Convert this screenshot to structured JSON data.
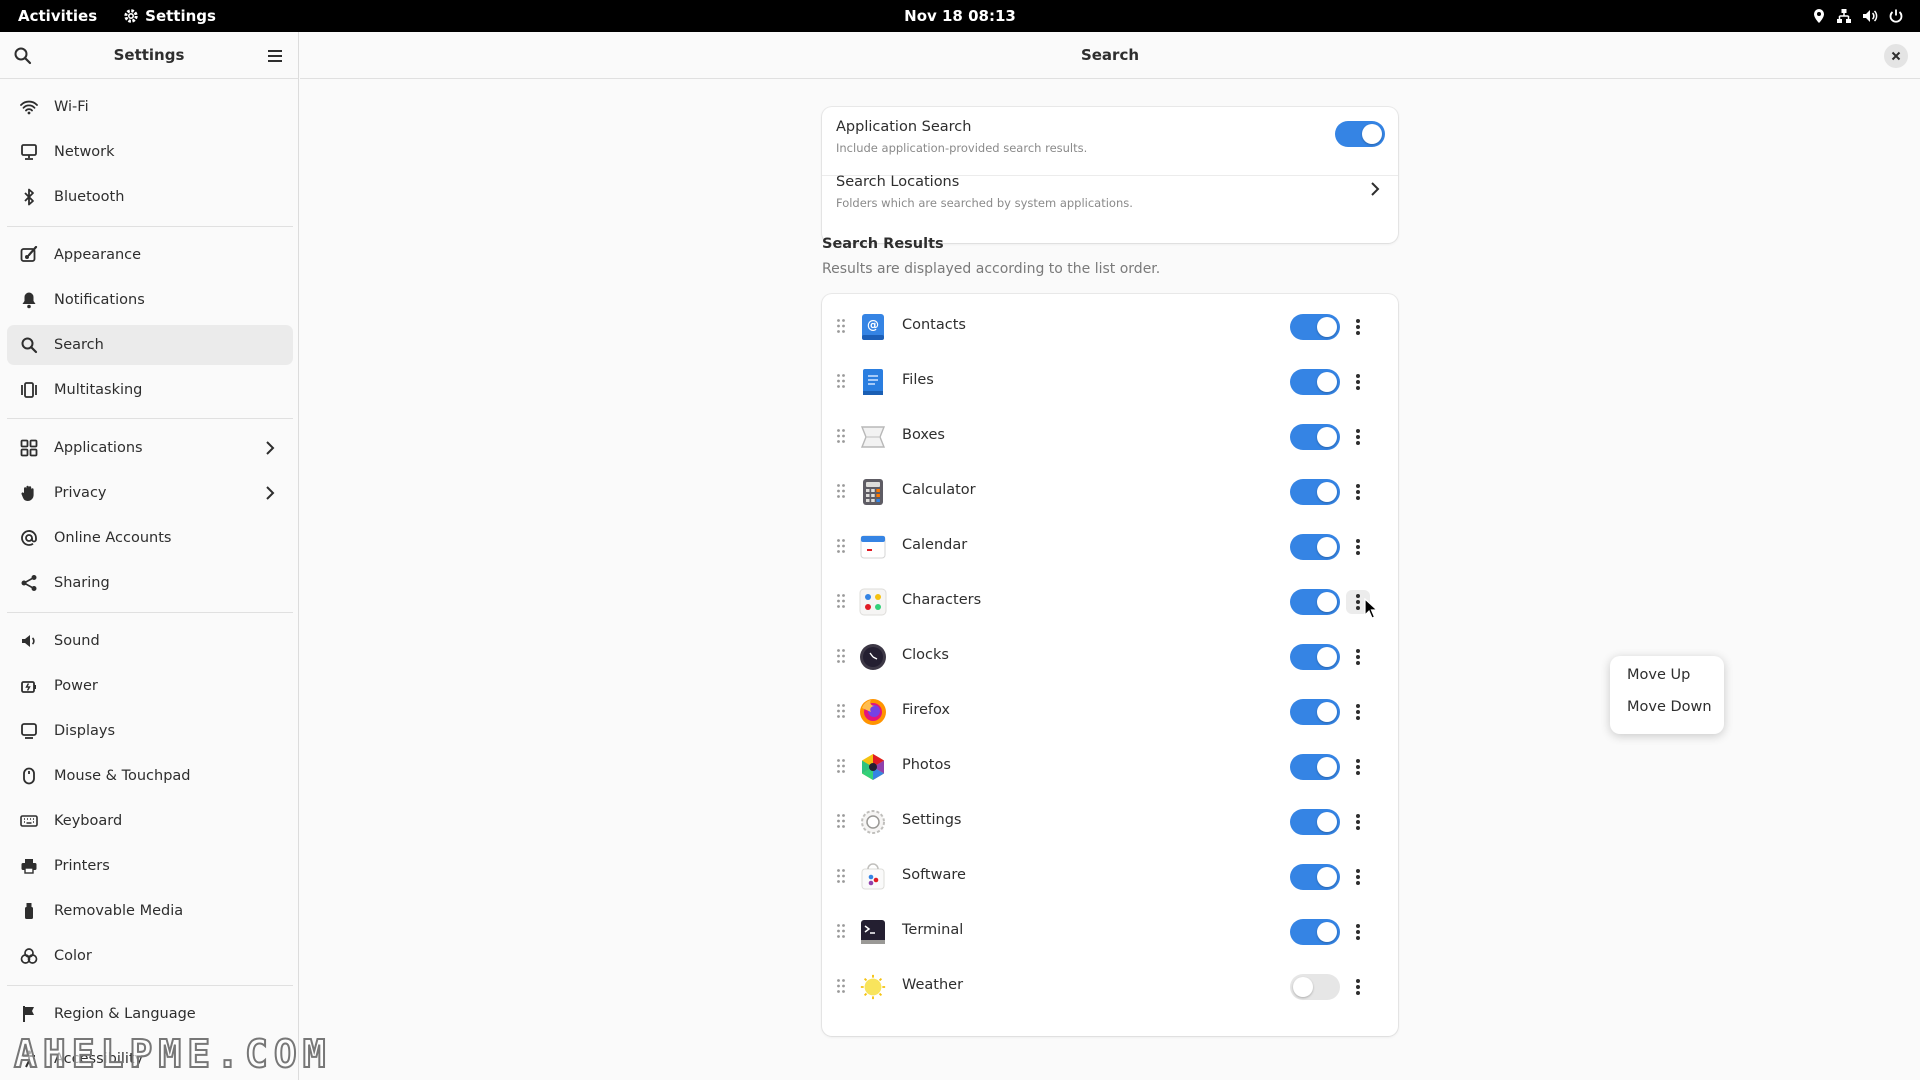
{
  "topbar": {
    "activities": "Activities",
    "app_name": "Settings",
    "datetime": "Nov 18  08:13"
  },
  "sidebar": {
    "title": "Settings",
    "items": [
      {
        "label": "Wi-Fi",
        "icon": "wifi-icon"
      },
      {
        "label": "Network",
        "icon": "network-icon"
      },
      {
        "label": "Bluetooth",
        "icon": "bluetooth-icon"
      },
      {
        "label": "Appearance",
        "icon": "appearance-icon"
      },
      {
        "label": "Notifications",
        "icon": "bell-icon"
      },
      {
        "label": "Search",
        "icon": "search-icon",
        "active": true
      },
      {
        "label": "Multitasking",
        "icon": "multitasking-icon"
      },
      {
        "label": "Applications",
        "icon": "applications-icon",
        "has_submenu": true
      },
      {
        "label": "Privacy",
        "icon": "privacy-hand-icon",
        "has_submenu": true
      },
      {
        "label": "Online Accounts",
        "icon": "at-icon"
      },
      {
        "label": "Sharing",
        "icon": "share-icon"
      },
      {
        "label": "Sound",
        "icon": "speaker-icon"
      },
      {
        "label": "Power",
        "icon": "power-icon"
      },
      {
        "label": "Displays",
        "icon": "display-icon"
      },
      {
        "label": "Mouse & Touchpad",
        "icon": "mouse-icon"
      },
      {
        "label": "Keyboard",
        "icon": "keyboard-icon"
      },
      {
        "label": "Printers",
        "icon": "printer-icon"
      },
      {
        "label": "Removable Media",
        "icon": "usb-drive-icon"
      },
      {
        "label": "Color",
        "icon": "color-icon"
      },
      {
        "label": "Region & Language",
        "icon": "flag-icon"
      },
      {
        "label": "Accessibility",
        "icon": "accessibility-icon"
      }
    ]
  },
  "main": {
    "title": "Search",
    "application_search": {
      "title": "Application Search",
      "subtitle": "Include application-provided search results.",
      "enabled": true
    },
    "search_locations": {
      "title": "Search Locations",
      "subtitle": "Folders which are searched by system applications."
    },
    "results_heading": "Search Results",
    "results_description": "Results are displayed according to the list order.",
    "results": [
      {
        "name": "Contacts",
        "icon": "contacts-icon",
        "enabled": true
      },
      {
        "name": "Files",
        "icon": "files-icon",
        "enabled": true
      },
      {
        "name": "Boxes",
        "icon": "boxes-icon",
        "enabled": true
      },
      {
        "name": "Calculator",
        "icon": "calculator-icon",
        "enabled": true
      },
      {
        "name": "Calendar",
        "icon": "calendar-icon",
        "enabled": true
      },
      {
        "name": "Characters",
        "icon": "characters-icon",
        "enabled": true
      },
      {
        "name": "Clocks",
        "icon": "clocks-icon",
        "enabled": true
      },
      {
        "name": "Firefox",
        "icon": "firefox-icon",
        "enabled": true
      },
      {
        "name": "Photos",
        "icon": "photos-icon",
        "enabled": true
      },
      {
        "name": "Settings",
        "icon": "settings-gear-icon",
        "enabled": true
      },
      {
        "name": "Software",
        "icon": "software-icon",
        "enabled": true
      },
      {
        "name": "Terminal",
        "icon": "terminal-icon",
        "enabled": true
      },
      {
        "name": "Weather",
        "icon": "weather-icon",
        "enabled": false
      }
    ],
    "popover": {
      "move_up": "Move Up",
      "move_down": "Move Down"
    }
  },
  "watermark": "AHELPME.COM",
  "colors": {
    "accent": "#3584e4",
    "topbar": "#000000"
  }
}
